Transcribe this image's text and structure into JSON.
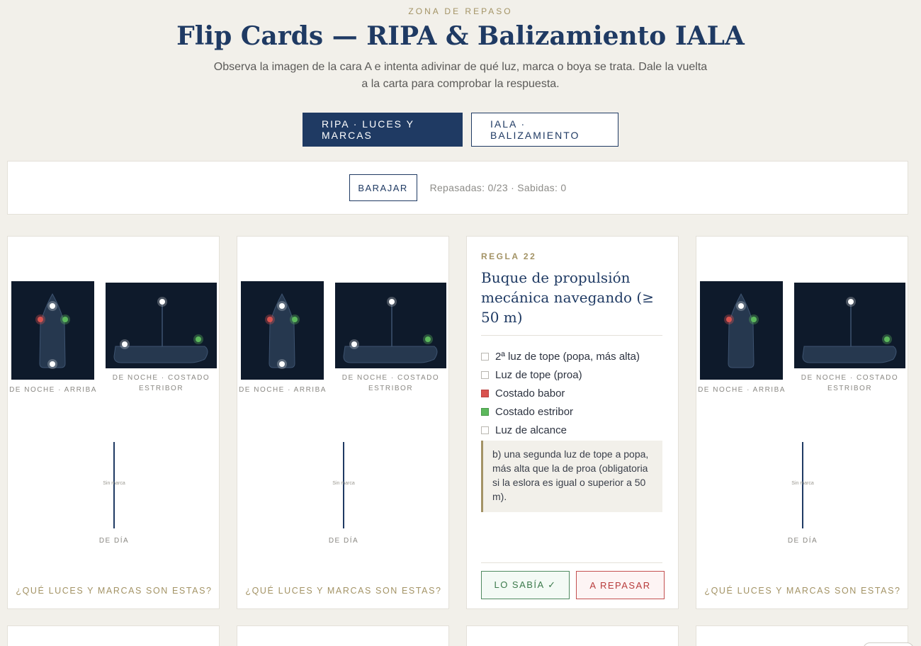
{
  "header": {
    "kicker": "ZONA DE REPASO",
    "title": "Flip Cards — RIPA & Balizamiento IALA",
    "subtitle": "Observa la imagen de la cara A e intenta adivinar de qué luz, marca o boya se trata. Dale la vuelta a la carta para comprobar la respuesta."
  },
  "tabs": [
    {
      "label": "RIPA · LUCES Y MARCAS",
      "active": true
    },
    {
      "label": "IALA · BALIZAMIENTO",
      "active": false
    }
  ],
  "toolbar": {
    "shuffle_label": "BARAJAR",
    "stats": "Repasadas: 0/23 · Sabidas: 0"
  },
  "colors": {
    "navy": "#1f3a63",
    "gold": "#a39365",
    "night_bg": "#0e1a2b",
    "red_light": "#d9534f",
    "green_light": "#5cb85c",
    "white_light": "#ffffff"
  },
  "front_cards": [
    {
      "caption_top": "DE NOCHE · ARRIBA",
      "caption_side": "DE NOCHE · COSTADO ESTRIBOR",
      "day_mark": "Sin marca",
      "day_label": "DE DÍA",
      "prompt": "¿QUÉ LUCES Y MARCAS SON ESTAS?"
    },
    {
      "caption_top": "DE NOCHE · ARRIBA",
      "caption_side": "DE NOCHE · COSTADO ESTRIBOR",
      "day_mark": "Sin marca",
      "day_label": "DE DÍA",
      "prompt": "¿QUÉ LUCES Y MARCAS SON ESTAS?"
    },
    {
      "caption_top": "DE NOCHE · ARRIBA",
      "caption_side": "DE NOCHE · COSTADO ESTRIBOR",
      "day_mark": "Sin marca",
      "day_label": "DE DÍA",
      "prompt": "¿QUÉ LUCES Y MARCAS SON ESTAS?"
    }
  ],
  "back_card": {
    "rule": "REGLA 22",
    "title": "Buque de propulsión mecánica navegando (≥ 50 m)",
    "legend": [
      {
        "label": "2ª luz de tope (popa, más alta)",
        "color": "#ffffff"
      },
      {
        "label": "Luz de tope (proa)",
        "color": "#ffffff"
      },
      {
        "label": "Costado babor",
        "color": "#d9534f"
      },
      {
        "label": "Costado estribor",
        "color": "#5cb85c"
      },
      {
        "label": "Luz de alcance",
        "color": "#ffffff"
      }
    ],
    "quote": "b) una segunda luz de tope a popa, más alta que la de proa (obligatoria si la eslora es igual o superior a 50 m).",
    "btn_know": "LO SABÍA ✓",
    "btn_review": "A REPASAR"
  }
}
